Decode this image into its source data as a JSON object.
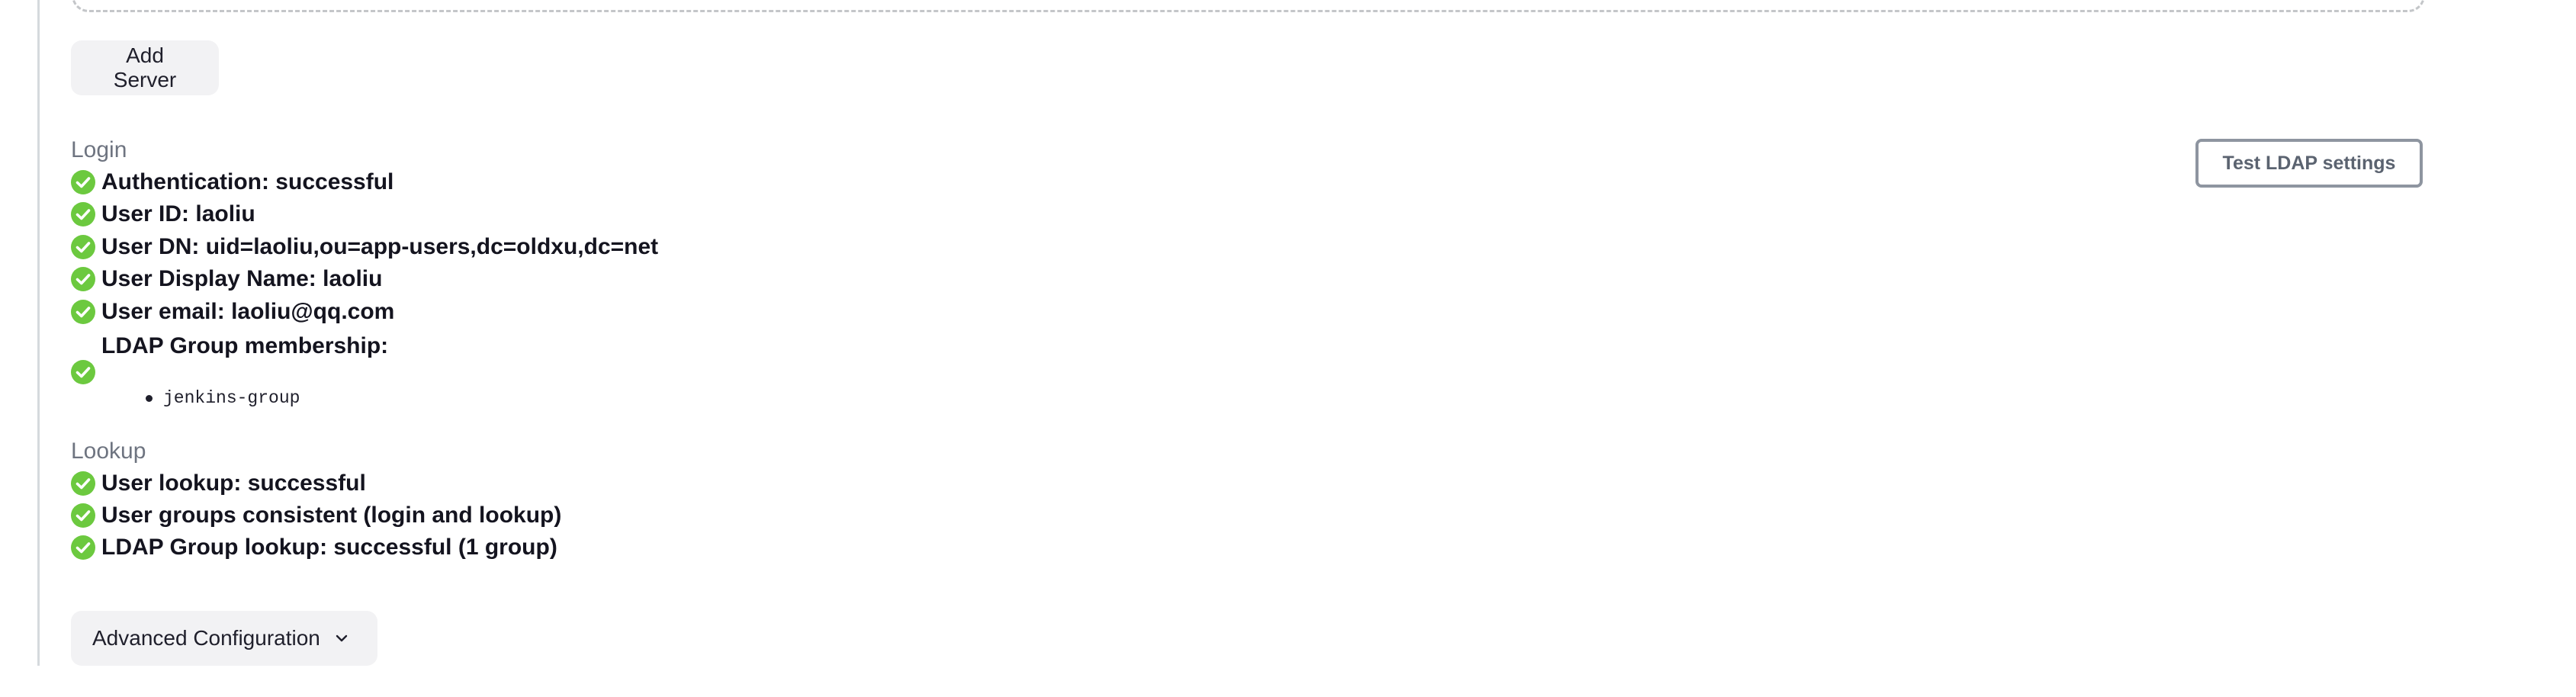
{
  "actions": {
    "add_server_label": "Add Server",
    "test_ldap_label": "Test LDAP settings",
    "advanced_config_label": "Advanced Configuration"
  },
  "login": {
    "title": "Login",
    "items": [
      {
        "text": "Authentication: successful",
        "status": "success"
      },
      {
        "text": "User ID: laoliu",
        "status": "success"
      },
      {
        "text": "User DN: uid=laoliu,ou=app-users,dc=oldxu,dc=net",
        "status": "success"
      },
      {
        "text": "User Display Name: laoliu",
        "status": "success"
      },
      {
        "text": "User email: laoliu@qq.com",
        "status": "success"
      }
    ],
    "group_membership": {
      "label": "LDAP Group membership:",
      "status": "success",
      "groups": [
        "jenkins-group"
      ]
    }
  },
  "lookup": {
    "title": "Lookup",
    "items": [
      {
        "text": "User lookup: successful",
        "status": "success"
      },
      {
        "text": "User groups consistent (login and lookup)",
        "status": "success"
      },
      {
        "text": "LDAP Group lookup: successful (1 group)",
        "status": "success"
      }
    ]
  },
  "icons": {
    "success": "check-circle-icon",
    "expand": "chevron-down-icon"
  },
  "colors": {
    "success": "#6cc93f",
    "muted_text": "#6e7480",
    "button_bg": "#f2f2f4",
    "test_button_border": "#8e95a0"
  }
}
